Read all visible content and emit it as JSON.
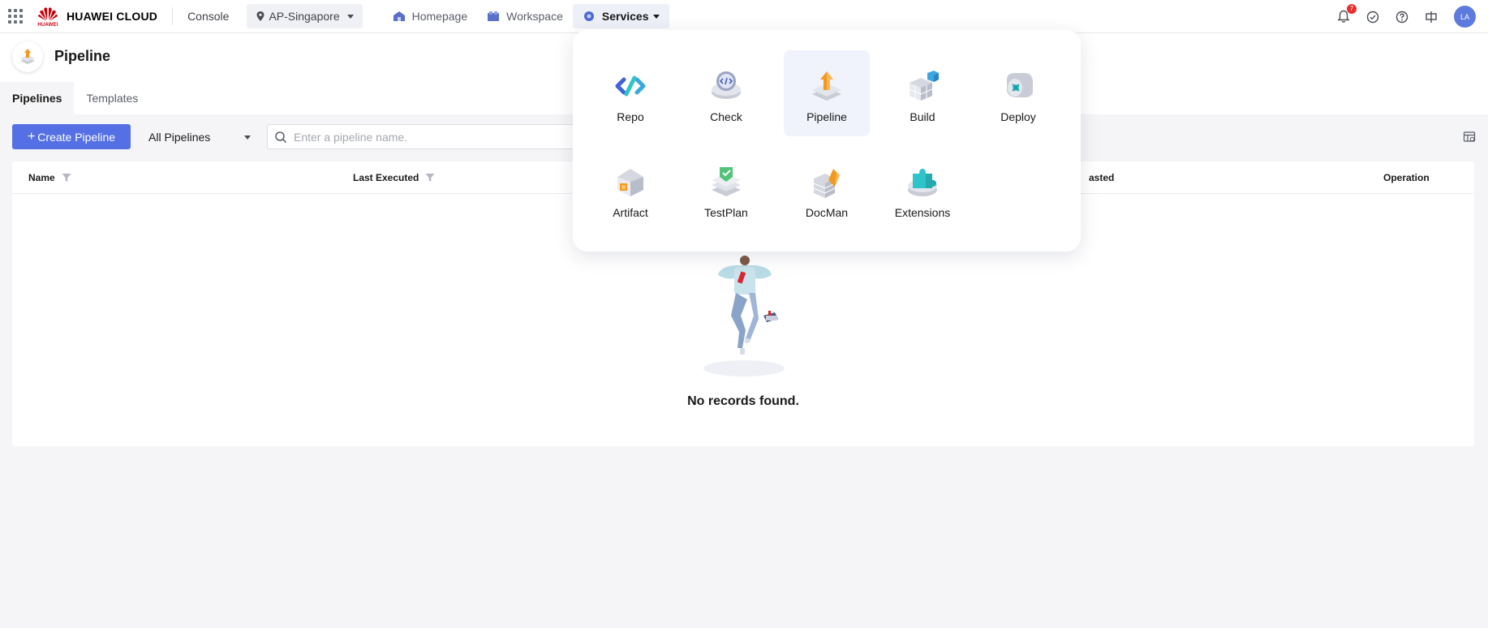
{
  "topbar": {
    "brand_name": "HUAWEI CLOUD",
    "brand_small": "HUAWEI",
    "console": "Console",
    "region": "AP-Singapore",
    "homepage": "Homepage",
    "workspace": "Workspace",
    "services": "Services",
    "notification_count": "7",
    "avatar_initials": "LA"
  },
  "page": {
    "title": "Pipeline",
    "tabs": [
      {
        "label": "Pipelines",
        "active": true
      },
      {
        "label": "Templates",
        "active": false
      }
    ]
  },
  "toolbar": {
    "create_label": "Create Pipeline",
    "filter_value": "All Pipelines",
    "search_placeholder": "Enter a pipeline name."
  },
  "table": {
    "columns": [
      "Name",
      "Last Executed",
      "asted",
      "Operation"
    ],
    "empty_text": "No records found."
  },
  "services_menu": {
    "items": [
      {
        "label": "Repo",
        "icon": "repo-icon"
      },
      {
        "label": "Check",
        "icon": "check-icon"
      },
      {
        "label": "Pipeline",
        "icon": "pipeline-icon",
        "active": true
      },
      {
        "label": "Build",
        "icon": "build-icon"
      },
      {
        "label": "Deploy",
        "icon": "deploy-icon"
      },
      {
        "label": "Artifact",
        "icon": "artifact-icon"
      },
      {
        "label": "TestPlan",
        "icon": "testplan-icon"
      },
      {
        "label": "DocMan",
        "icon": "docman-icon"
      },
      {
        "label": "Extensions",
        "icon": "extensions-icon"
      }
    ]
  },
  "colors": {
    "primary": "#5470e4",
    "brand_red": "#c7000b",
    "badge": "#e6302f",
    "avatar": "#5d7bdf"
  }
}
